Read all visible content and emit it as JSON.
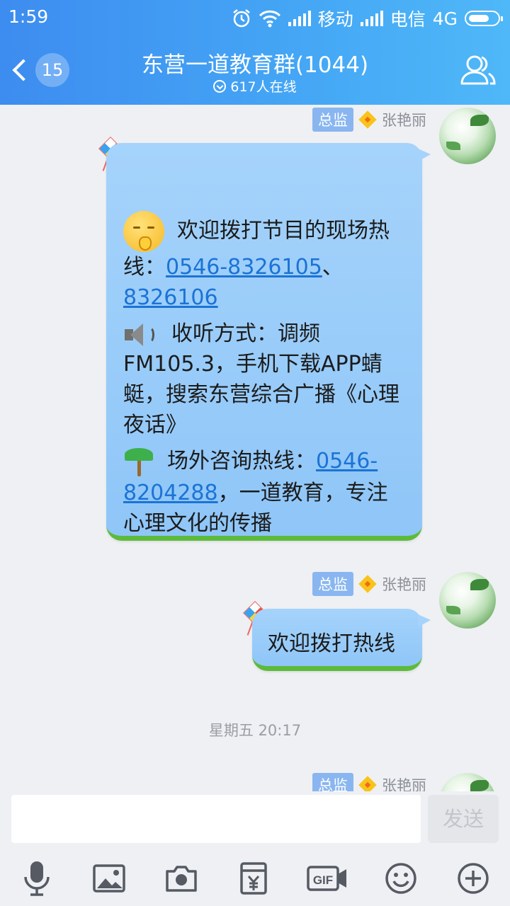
{
  "status_bar": {
    "time": "1:59",
    "carrier1": "移动",
    "carrier2": "电信",
    "network": "4G"
  },
  "header": {
    "unread_count": "15",
    "title": "东营一道教育群(1044)",
    "online": "617人在线"
  },
  "messages": [
    {
      "role": "总监",
      "sender": "张艳丽",
      "seg1_text": "欢迎拨打节目的现场热线：",
      "seg1_link1": "0546-8326105",
      "seg1_sep": "、",
      "seg1_link2": "8326106",
      "seg2_text": "收听方式：调频FM105.3，手机下载APP蜻蜓，搜索东营综合广播《心理夜话》",
      "seg3_text": "场外咨询热线：",
      "seg3_link": "0546-8204288",
      "seg3_tail": "，一道教育，专注心理文化的传播"
    },
    {
      "role": "总监",
      "sender": "张艳丽",
      "text": "欢迎拨打热线"
    },
    {
      "role": "总监",
      "sender": "张艳丽"
    }
  ],
  "timestamp": "星期五 20:17",
  "composer": {
    "placeholder": "",
    "send_label": "发送"
  },
  "toolbar_icons": [
    "microphone-icon",
    "image-icon",
    "camera-icon",
    "red-packet-icon",
    "gif-icon",
    "emoji-icon",
    "plus-icon"
  ],
  "colors": {
    "header_start": "#3d8cf0",
    "header_end": "#4fb8f8",
    "bubble": "#a5d3fb",
    "grass": "#5cbb3a",
    "link": "#1b73d6",
    "role_badge": "#89b6f0"
  }
}
